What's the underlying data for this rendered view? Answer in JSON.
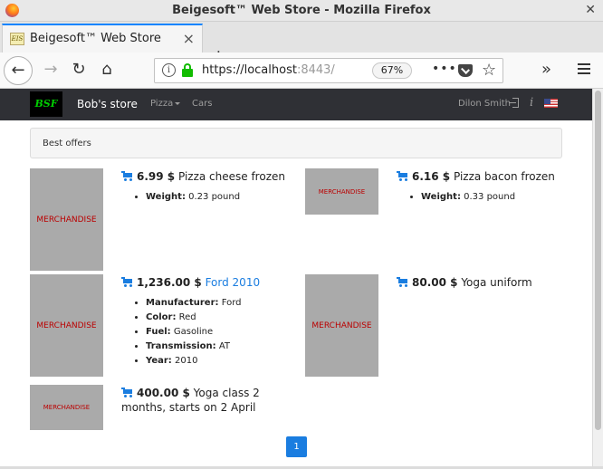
{
  "window": {
    "title": "Beigesoft™ Web Store - Mozilla Firefox",
    "close": "✕"
  },
  "tab": {
    "favicon": "EIS",
    "label": "Beigesoft™ Web Store",
    "close": "×",
    "new_tab": "+"
  },
  "navbar": {
    "back": "←",
    "forward": "→",
    "reload": "↻",
    "home": "⌂",
    "url_main": "https://localhost",
    "url_port": ":8443/",
    "zoom": "67%",
    "more": "•••",
    "star": "☆",
    "overflow": "»"
  },
  "site": {
    "logo": "BSF",
    "brand": "Bob's store",
    "nav": {
      "pizza": "Pizza",
      "cars": "Cars"
    },
    "user": "Dilon Smith",
    "info": "i"
  },
  "panel_title": "Best offers",
  "merch_label": "MERCHANDISE",
  "items": [
    {
      "price": "6.99 $",
      "name": "Pizza cheese frozen",
      "attrs": [
        {
          "k": "Weight:",
          "v": "0.23 pound"
        }
      ]
    },
    {
      "price": "6.16 $",
      "name": "Pizza bacon frozen",
      "attrs": [
        {
          "k": "Weight:",
          "v": "0.33 pound"
        }
      ]
    },
    {
      "price": "1,236.00 $",
      "name": "Ford 2010",
      "attrs": [
        {
          "k": "Manufacturer:",
          "v": "Ford"
        },
        {
          "k": "Color:",
          "v": "Red"
        },
        {
          "k": "Fuel:",
          "v": "Gasoline"
        },
        {
          "k": "Transmission:",
          "v": "AT"
        },
        {
          "k": "Year:",
          "v": "2010"
        }
      ]
    },
    {
      "price": "80.00 $",
      "name": "Yoga uniform",
      "attrs": []
    },
    {
      "price": "400.00 $",
      "name": "Yoga class 2",
      "name_line2": "months, starts on 2 April",
      "attrs": []
    }
  ],
  "pagination": {
    "current": "1"
  },
  "colors": {
    "accent": "#1a7de0",
    "site_nav": "#2f3035",
    "merch_bg": "#aaaaaa",
    "merch_text": "#bb0000"
  }
}
